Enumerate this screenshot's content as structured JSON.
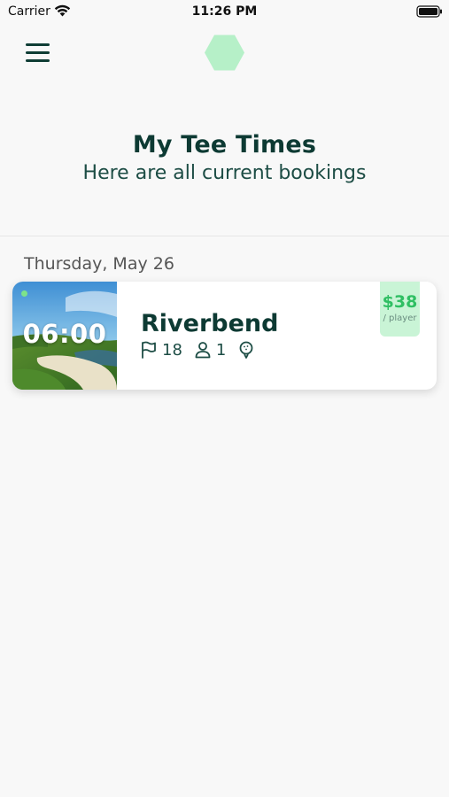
{
  "status_bar": {
    "carrier": "Carrier",
    "time": "11:26 PM"
  },
  "header": {
    "menu_icon": "hamburger-menu-icon",
    "logo_icon": "hexagon-logo",
    "logo_color": "#b6f0c8"
  },
  "page": {
    "title": "My Tee Times",
    "subtitle": "Here are all current bookings"
  },
  "bookings": [
    {
      "date": "Thursday, May 26",
      "time": "06:00",
      "course": "Riverbend",
      "holes": "18",
      "players": "1",
      "price": "$38",
      "price_unit": "/ player",
      "icons": [
        "flag-icon",
        "user-icon",
        "golf-ball-icon"
      ]
    }
  ],
  "colors": {
    "primary_dark": "#0d3a33",
    "accent_green": "#2fbf63",
    "price_bg": "#c9f4d6",
    "background": "#f8f8f8"
  }
}
